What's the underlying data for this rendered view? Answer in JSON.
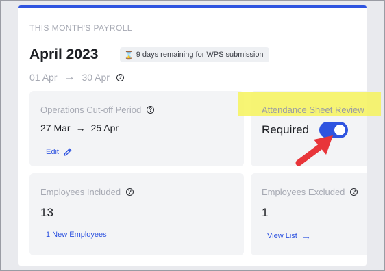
{
  "payroll": {
    "eyebrow": "THIS MONTH'S PAYROLL",
    "month_title": "April 2023",
    "wps_notice": "9 days remaining for WPS submission",
    "date_start": "01 Apr",
    "date_end": "30 Apr"
  },
  "tiles": {
    "cutoff": {
      "label": "Operations Cut-off Period",
      "start": "27 Mar",
      "end": "25 Apr",
      "link": "Edit"
    },
    "attendance": {
      "label": "Attendance Sheet Review",
      "value": "Required",
      "toggle_on": true
    },
    "included": {
      "label": "Employees Included",
      "value": "13",
      "link": "1 New Employees"
    },
    "excluded": {
      "label": "Employees Excluded",
      "value": "1",
      "link": "View List"
    }
  },
  "icons": [
    "hourglass-icon",
    "arrow-right-icon",
    "help-icon",
    "pencil-icon",
    "annotation-arrow-icon"
  ],
  "colors": {
    "accent": "#2f54e0",
    "highlight": "#f6f35c",
    "annotation_arrow": "#e8353a",
    "muted_text": "#a6a9b3"
  }
}
